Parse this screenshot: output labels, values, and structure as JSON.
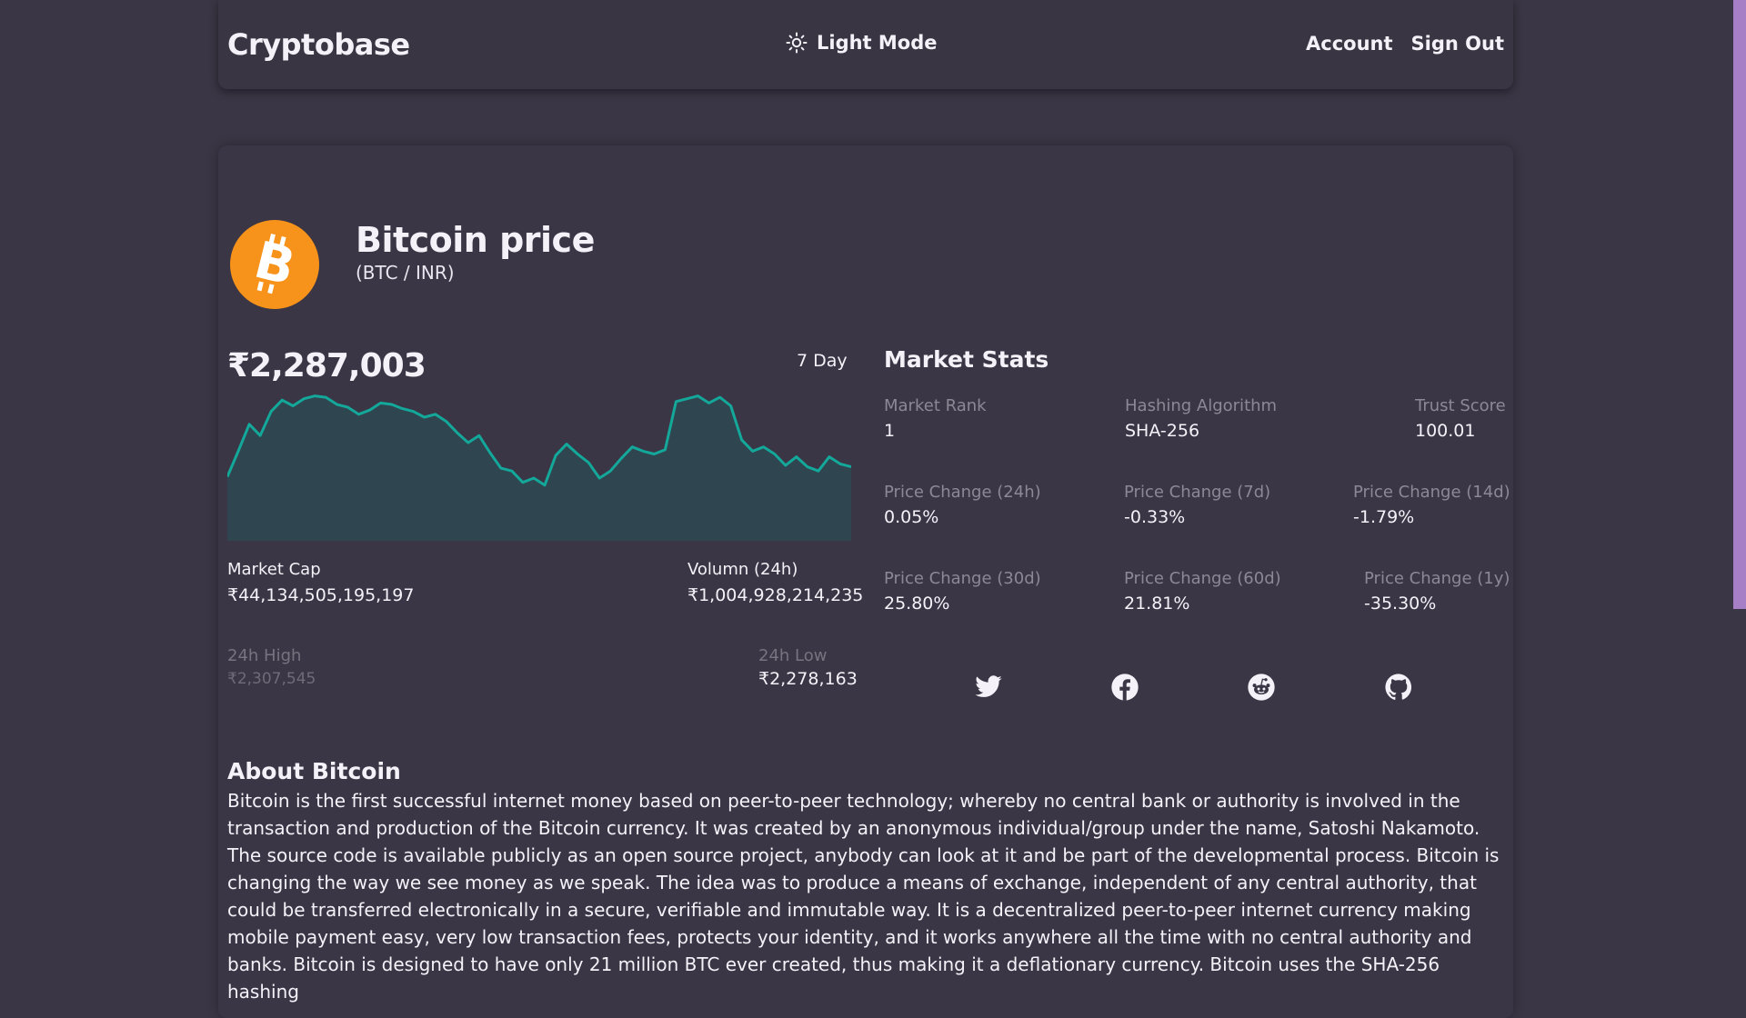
{
  "header": {
    "brand": "Cryptobase",
    "theme_toggle_label": "Light Mode",
    "links": [
      "Account",
      "Sign Out"
    ]
  },
  "coin": {
    "title": "Bitcoin price",
    "pair": "(BTC / INR)",
    "logo_color": "#f7931a",
    "current_price": "₹2,287,003",
    "range_label": "7 Day",
    "market_cap_label": "Market Cap",
    "market_cap": "₹44,134,505,195,197",
    "volume_label": "Volumn (24h)",
    "volume": "₹1,004,928,214,235",
    "high_label": "24h High",
    "high": "₹2,307,545",
    "low_label": "24h Low",
    "low": "₹2,278,163"
  },
  "market_stats": {
    "title": "Market Stats",
    "rows": [
      [
        {
          "label": "Market Rank",
          "value": "1"
        },
        {
          "label": "Hashing Algorithm",
          "value": "SHA-256"
        },
        {
          "label": "Trust Score",
          "value": "100.01"
        }
      ],
      [
        {
          "label": "Price Change (24h)",
          "value": "0.05%"
        },
        {
          "label": "Price Change (7d)",
          "value": "-0.33%"
        },
        {
          "label": "Price Change (14d)",
          "value": "-1.79%"
        }
      ],
      [
        {
          "label": "Price Change (30d)",
          "value": "25.80%"
        },
        {
          "label": "Price Change (60d)",
          "value": "21.81%"
        },
        {
          "label": "Price Change (1y)",
          "value": "-35.30%"
        }
      ]
    ]
  },
  "social_icons": [
    "twitter-icon",
    "facebook-icon",
    "reddit-icon",
    "github-icon"
  ],
  "about": {
    "title": "About Bitcoin",
    "text": "Bitcoin is the first successful internet money based on peer-to-peer technology; whereby no central bank or authority is involved in the transaction and production of the Bitcoin currency. It was created by an anonymous individual/group under the name, Satoshi Nakamoto. The source code is available publicly as an open source project, anybody can look at it and be part of the developmental process. Bitcoin is changing the way we see money as we speak. The idea was to produce a means of exchange, independent of any central authority, that could be transferred electronically in a secure, verifiable and immutable way. It is a decentralized peer-to-peer internet currency making mobile payment easy, very low transaction fees, protects your identity, and it works anywhere all the time with no central authority and banks. Bitcoin is designed to have only 21 million BTC ever created, thus making it a deflationary currency. Bitcoin uses the SHA-256 hashing"
  },
  "colors": {
    "background": "#3a3645",
    "sparkline_line": "#13a89a",
    "sparkline_fill": "#2f4650",
    "scrollbar": "#a67fc7"
  },
  "sparkline": {
    "values": [
      0.42,
      0.6,
      0.79,
      0.71,
      0.88,
      0.96,
      0.92,
      0.97,
      0.99,
      0.98,
      0.93,
      0.91,
      0.86,
      0.89,
      0.94,
      0.93,
      0.9,
      0.88,
      0.84,
      0.86,
      0.81,
      0.73,
      0.66,
      0.71,
      0.59,
      0.48,
      0.46,
      0.38,
      0.41,
      0.36,
      0.57,
      0.65,
      0.58,
      0.52,
      0.41,
      0.46,
      0.55,
      0.63,
      0.6,
      0.58,
      0.61,
      0.95,
      0.97,
      0.99,
      0.94,
      0.98,
      0.92,
      0.68,
      0.6,
      0.63,
      0.58,
      0.5,
      0.56,
      0.49,
      0.46,
      0.56,
      0.51,
      0.49
    ]
  }
}
